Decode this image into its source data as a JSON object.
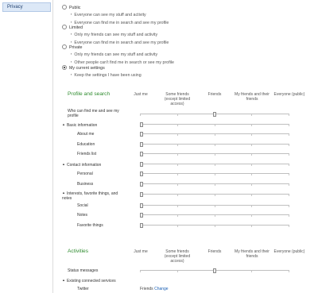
{
  "sidebar": {
    "items": [
      {
        "label": "Privacy"
      }
    ]
  },
  "options": [
    {
      "label": "Public",
      "selected": false,
      "bullets": [
        "Everyone can see my stuff and activity",
        "Everyone can find me in search and see my profile"
      ]
    },
    {
      "label": "Limited",
      "selected": false,
      "bullets": [
        "Only my friends can see my stuff and activity",
        "Everyone can find me in search and see my profile"
      ]
    },
    {
      "label": "Private",
      "selected": false,
      "bullets": [
        "Only my friends can see my stuff and activity",
        "Other people can't find me in search or see my profile"
      ]
    },
    {
      "label": "My current settings",
      "selected": true,
      "bullets": [
        "Keep the settings I have been using"
      ]
    }
  ],
  "columns": [
    "Just me",
    "Some friends (except limited access)",
    "Friends",
    "My friends and their friends",
    "Everyone (public)"
  ],
  "profile": {
    "title": "Profile and search",
    "rows": [
      {
        "label": "Who can find me and see my profile",
        "level": 2
      },
      {
        "label": "Basic information",
        "level": 0
      },
      {
        "label": "About me",
        "level": 0
      },
      {
        "label": "Education",
        "level": 0
      },
      {
        "label": "Friends list",
        "level": 0
      },
      {
        "label": "Contact information",
        "level": 0
      },
      {
        "label": "Personal",
        "level": 0
      },
      {
        "label": "Business",
        "level": 0
      },
      {
        "label": "Interests, favorite things, and notes",
        "level": 0
      },
      {
        "label": "Social",
        "level": 0
      },
      {
        "label": "Notes",
        "level": 0
      },
      {
        "label": "Favorite things",
        "level": 0
      }
    ]
  },
  "activities": {
    "title": "Activities",
    "rows": [
      {
        "label": "Status messages",
        "level": 2
      },
      {
        "label": "Existing connected services"
      },
      {
        "label": "Twitter",
        "value": "Friends",
        "link": "Change"
      }
    ]
  },
  "colors": {
    "accent": "#2e8b2e",
    "link": "#1a5fb4",
    "selection": "#dce8f7"
  }
}
